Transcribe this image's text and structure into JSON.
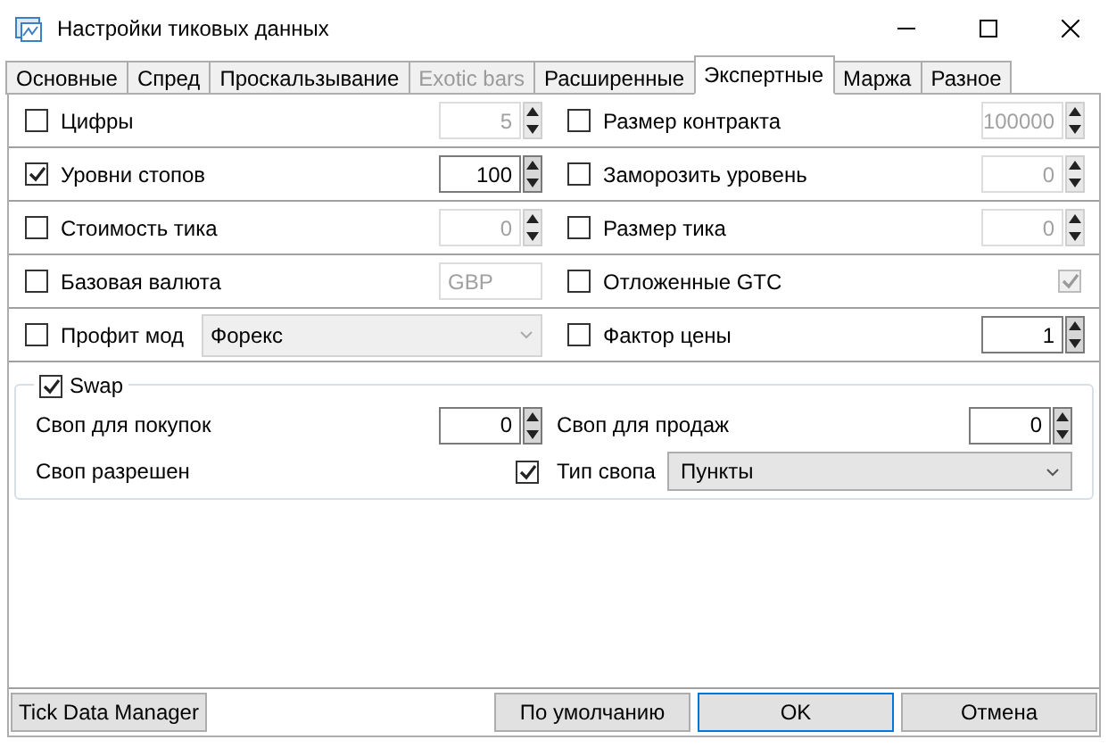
{
  "window": {
    "title": "Настройки тиковых данных"
  },
  "tabs": [
    {
      "label": "Основные",
      "selected": false,
      "disabled": false
    },
    {
      "label": "Спред",
      "selected": false,
      "disabled": false
    },
    {
      "label": "Проскальзывание",
      "selected": false,
      "disabled": false
    },
    {
      "label": "Exotic bars",
      "selected": false,
      "disabled": true
    },
    {
      "label": "Расширенные",
      "selected": false,
      "disabled": false
    },
    {
      "label": "Экспертные",
      "selected": true,
      "disabled": false
    },
    {
      "label": "Маржа",
      "selected": false,
      "disabled": false
    },
    {
      "label": "Разное",
      "selected": false,
      "disabled": false
    }
  ],
  "rows": [
    {
      "left": {
        "label": "Цифры",
        "checked": false,
        "control": {
          "kind": "spin",
          "value": "5",
          "disabled": true
        }
      },
      "right": {
        "label": "Размер контракта",
        "checked": false,
        "control": {
          "kind": "spin",
          "value": "100000",
          "disabled": true
        }
      }
    },
    {
      "left": {
        "label": "Уровни стопов",
        "checked": true,
        "control": {
          "kind": "spin",
          "value": "100",
          "disabled": false
        }
      },
      "right": {
        "label": "Заморозить уровень",
        "checked": false,
        "control": {
          "kind": "spin",
          "value": "0",
          "disabled": true
        }
      }
    },
    {
      "left": {
        "label": "Стоимость тика",
        "checked": false,
        "control": {
          "kind": "spin",
          "value": "0",
          "disabled": true
        }
      },
      "right": {
        "label": "Размер тика",
        "checked": false,
        "control": {
          "kind": "spin",
          "value": "0",
          "disabled": true
        }
      }
    },
    {
      "left": {
        "label": "Базовая валюта",
        "checked": false,
        "control": {
          "kind": "text",
          "value": "GBP",
          "disabled": true
        }
      },
      "right": {
        "label": "Отложенные GTC",
        "checked": false,
        "control": {
          "kind": "check",
          "checked": true,
          "disabled": true
        }
      }
    },
    {
      "left": {
        "label": "Профит мод",
        "checked": false,
        "control": {
          "kind": "select",
          "value": "Форекс",
          "disabled": true
        }
      },
      "right": {
        "label": "Фактор цены",
        "checked": false,
        "control": {
          "kind": "spin",
          "value": "1",
          "disabled": false
        }
      }
    }
  ],
  "swap": {
    "label": "Swap",
    "checked": true,
    "buy": {
      "label": "Своп для покупок",
      "value": "0"
    },
    "sell": {
      "label": "Своп для продаж",
      "value": "0"
    },
    "allowed": {
      "label": "Своп разрешен",
      "checked": true
    },
    "type": {
      "label": "Тип свопа",
      "value": "Пункты"
    }
  },
  "buttons": {
    "left": {
      "label": "Tick Data Manager",
      "focused": false
    },
    "right": [
      {
        "label": "По умолчанию",
        "focused": false
      },
      {
        "label": "OK",
        "focused": true
      },
      {
        "label": "Отмена",
        "focused": false
      }
    ]
  }
}
